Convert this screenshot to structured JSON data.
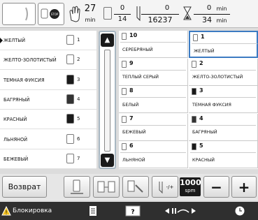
{
  "top_bar": {
    "total_colors": "27",
    "total_colors_unit": "min",
    "color_order_current": "0",
    "color_order_total": "14",
    "stitch_current": "0",
    "stitch_total": "16237",
    "time_current": "0",
    "time_unit": "min",
    "time_total": "34",
    "time_total_unit": "min"
  },
  "color_list": [
    {
      "name": "ЖЕЛТЫЙ",
      "num": "1",
      "color": "#ffffff",
      "active": true
    },
    {
      "name": "ЖЕЛТО-ЗОЛОТИСТЫЙ",
      "num": "2",
      "color": "#ffffff"
    },
    {
      "name": "ТЕМНАЯ ФУКСИЯ",
      "num": "3",
      "color": "#1a1a1a"
    },
    {
      "name": "БАГРЯНЫЙ",
      "num": "4",
      "color": "#333333"
    },
    {
      "name": "КРАСНЫЙ",
      "num": "5",
      "color": "#1a1a1a"
    },
    {
      "name": "ЛЬНЯНОЙ",
      "num": "6",
      "color": "#ffffff"
    },
    {
      "name": "БЕЖЕВЫЙ",
      "num": "7",
      "color": "#ffffff"
    }
  ],
  "grid": [
    {
      "num": "10",
      "name": "СЕРЕБРЯНЫЙ",
      "color": "#ffffff"
    },
    {
      "num": "1",
      "name": "ЖЕЛТЫЙ",
      "color": "#ffffff",
      "selected": true
    },
    {
      "num": "9",
      "name": "ТЕПЛЫЙ СЕРЫЙ",
      "color": "#ffffff"
    },
    {
      "num": "2",
      "name": "ЖЕЛТО-ЗОЛОТИСТЫЙ",
      "color": "#ffffff"
    },
    {
      "num": "8",
      "name": "БЕЛЫЙ",
      "color": "#ffffff"
    },
    {
      "num": "3",
      "name": "ТЕМНАЯ ФУКСИЯ",
      "color": "#1a1a1a"
    },
    {
      "num": "7",
      "name": "БЕЖЕВЫЙ",
      "color": "#ffffff"
    },
    {
      "num": "4",
      "name": "БАГРЯНЫЙ",
      "color": "#333333"
    },
    {
      "num": "6",
      "name": "ЛЬНЯНОЙ",
      "color": "#ffffff"
    },
    {
      "num": "5",
      "name": "КРАСНЫЙ",
      "color": "#1a1a1a"
    }
  ],
  "buttons": {
    "back_label": "Возврат",
    "speed_value": "1000",
    "speed_unit": "spm",
    "minus_label": "−",
    "plus_label": "+",
    "spm_minus_label": "-/+"
  },
  "status": {
    "lock_label": "Блокировка"
  },
  "icons": {
    "stop": "stop-icon",
    "hand": "hand-icon",
    "spool": "spool-icon",
    "needle": "needle-icon",
    "hourglass": "hourglass-icon"
  },
  "colors": {
    "accent_blue": "#3c7bc2",
    "scroll_dark": "#1a1a1a",
    "status_bg": "#2f2f2f"
  }
}
